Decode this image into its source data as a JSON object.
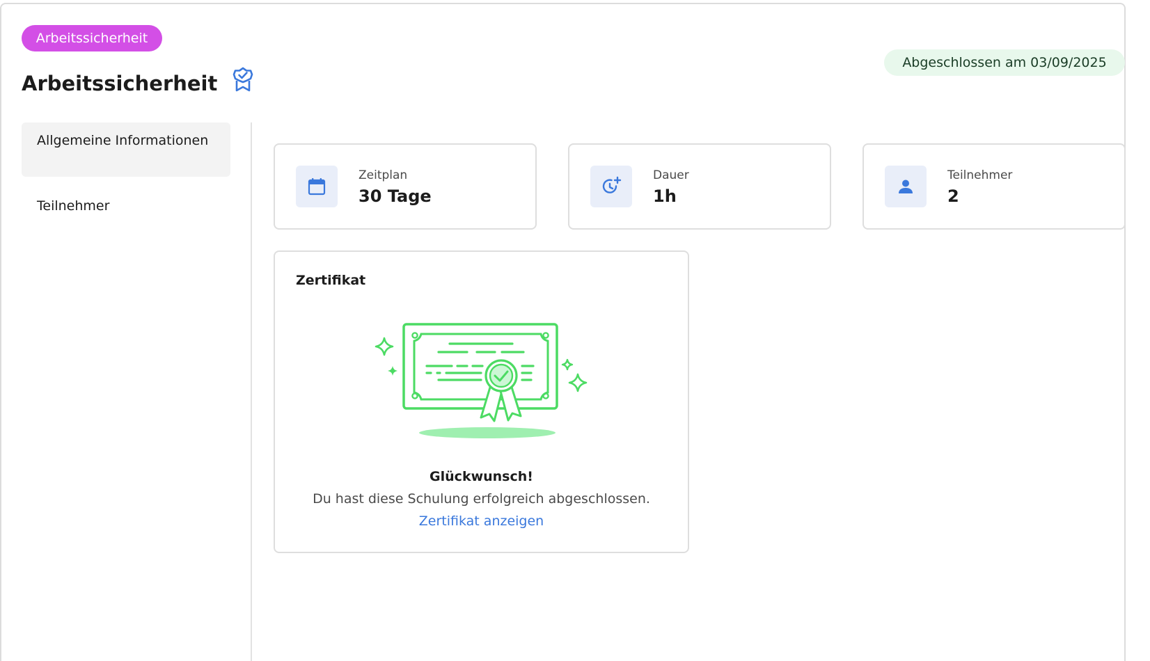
{
  "header": {
    "category_tag": "Arbeitssicherheit",
    "title": "Arbeitssicherheit",
    "title_icon": "award-badge-icon",
    "status": "Abgeschlossen am 03/09/2025"
  },
  "sidebar": {
    "items": [
      {
        "label": "Allgemeine Informationen",
        "active": true
      },
      {
        "label": "Teilnehmer",
        "active": false
      }
    ]
  },
  "stats": [
    {
      "icon": "calendar-icon",
      "label": "Zeitplan",
      "value": "30 Tage"
    },
    {
      "icon": "clock-plus-icon",
      "label": "Dauer",
      "value": "1h"
    },
    {
      "icon": "person-icon",
      "label": "Teilnehmer",
      "value": "2"
    }
  ],
  "certificate": {
    "title": "Zertifikat",
    "illustration": "certificate-illustration",
    "heading": "Glückwunsch!",
    "text": "Du hast diese Schulung erfolgreich abgeschlossen.",
    "link": "Zertifikat anzeigen"
  },
  "colors": {
    "tag": "#d34fe6",
    "status_bg": "#e8f8ec",
    "accent_blue": "#3a78dc",
    "certificate_green": "#4cdb63"
  }
}
